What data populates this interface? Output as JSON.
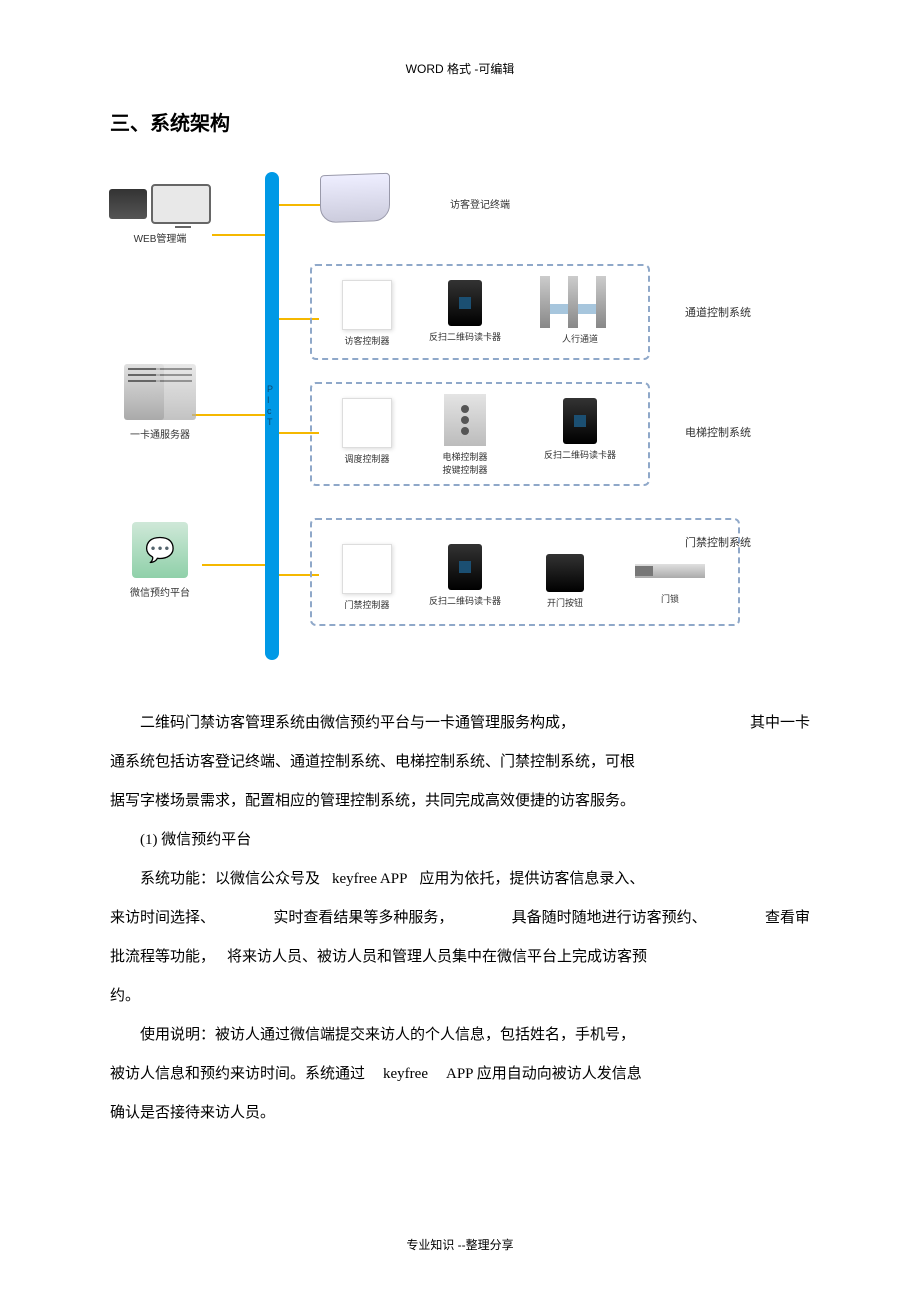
{
  "header_watermark": "WORD 格式 -可编辑",
  "section_heading": "三、系统架构",
  "diagram": {
    "backbone_label": "P\nI\nc\nT",
    "left": {
      "web_mgmt": "WEB管理端",
      "card_server": "一卡通服务器",
      "wechat_platform": "微信预约平台"
    },
    "visitor_terminal": "访客登记终端",
    "group1": {
      "title": "通道控制系统",
      "dev1": "访客控制器",
      "dev2": "反扫二维码读卡器",
      "dev3": "人行通道"
    },
    "group2": {
      "title": "电梯控制系统",
      "dev1": "调度控制器",
      "dev2a": "电梯控制器",
      "dev2b": "按键控制器",
      "dev3": "反扫二维码读卡器"
    },
    "group3": {
      "title": "门禁控制系统",
      "dev1": "门禁控制器",
      "dev2": "反扫二维码读卡器",
      "dev3": "开门按钮",
      "dev4": "门锁"
    }
  },
  "paragraphs": {
    "p1a": "二维码门禁访客管理系统由微信预约平台与一卡通管理服务构成，",
    "p1b": "其中一卡",
    "p2": "通系统包括访客登记终端、通道控制系统、电梯控制系统、门禁控制系统，可根",
    "p3": "据写字楼场景需求，配置相应的管理控制系统，共同完成高效便捷的访客服务。",
    "h1": "(1)  微信预约平台",
    "p4a": "系统功能：以微信公众号及",
    "p4b": "keyfree APP",
    "p4c": "应用为依托，提供访客信息录入、",
    "p5a": "来访时间选择、",
    "p5b": "实时查看结果等多种服务，",
    "p5c": "具备随时随地进行访客预约、",
    "p5d": "查看审",
    "p6a": "批流程等功能，",
    "p6b": "将来访人员、被访人员和管理人员集中在微信平台上完成访客预",
    "p7": "约。",
    "p8": "使用说明：被访人通过微信端提交来访人的个人信息，包括姓名，手机号，",
    "p9a": "被访人信息和预约来访时间。系统通过",
    "p9b": "keyfree",
    "p9c": "APP 应用自动向被访人发信息",
    "p10": "确认是否接待来访人员。"
  },
  "footer": "专业知识 --整理分享"
}
